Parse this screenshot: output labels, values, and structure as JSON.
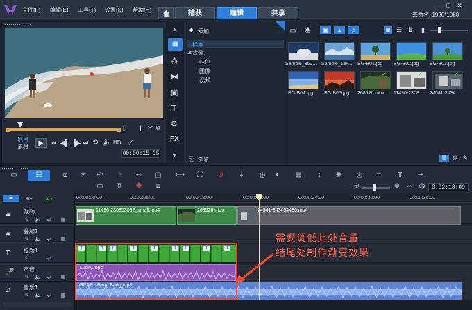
{
  "menu": [
    "文件(F)",
    "编辑(E)",
    "工具(T)",
    "设置(S)",
    "帮助(H)"
  ],
  "tabs": [
    {
      "label": "捕获"
    },
    {
      "label": "编辑"
    },
    {
      "label": "共享"
    }
  ],
  "project_info": "未命名, 1920*1080",
  "library": {
    "add_label": "添加",
    "tree": [
      "样本",
      "背景",
      "纯色",
      "图像",
      "视频"
    ],
    "browse_label": "浏览"
  },
  "thumbnails": [
    {
      "label": "Sample_360..."
    },
    {
      "label": "Sample_Lak..."
    },
    {
      "label": "BG-B01.jpg"
    },
    {
      "label": "BG-B02.jpg"
    },
    {
      "label": "BG-B03.jpg"
    },
    {
      "label": "BG-B04.jpg"
    },
    {
      "label": "BG-B05.jpg"
    },
    {
      "label": "268526.mov"
    },
    {
      "label": "11490-2308..."
    },
    {
      "label": "24541-3434..."
    }
  ],
  "preview": {
    "mode1": "项目",
    "mode2": "素材",
    "hd": "HD",
    "timecode": "00:00:15:05"
  },
  "timeline": {
    "zoom_timecode": "0:02:18:09",
    "ruler": [
      "00:00:00:00",
      "00:00:06:00",
      "00:00:12:00",
      "00:00:18:00",
      "00:00:24:00",
      "00:00:30:00",
      "00:00:36:00"
    ],
    "tracks": [
      {
        "name": "视频"
      },
      {
        "name": "叠加1"
      },
      {
        "name": "标题1"
      },
      {
        "name": "声音"
      },
      {
        "name": "音乐1"
      }
    ],
    "clips": {
      "v1": "11490-230853032_small.mp4",
      "v2": "268526.mov",
      "v3": "24541-343454486.mp4",
      "voice": "Lucky.mp4",
      "music": "GRAE - Bang Bang.mp3"
    }
  },
  "annotation": {
    "line1": "需要调低此处音量",
    "line2": "结尾处制作渐变效果"
  }
}
